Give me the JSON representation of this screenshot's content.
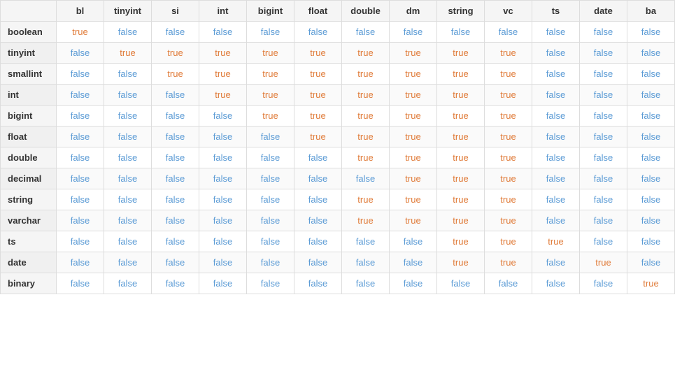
{
  "table": {
    "columns": [
      "",
      "bl",
      "tinyint",
      "si",
      "int",
      "bigint",
      "float",
      "double",
      "dm",
      "string",
      "vc",
      "ts",
      "date",
      "ba"
    ],
    "rows": [
      {
        "label": "boolean",
        "values": [
          "true",
          "false",
          "false",
          "false",
          "false",
          "false",
          "false",
          "false",
          "false",
          "false",
          "false",
          "false",
          "false"
        ]
      },
      {
        "label": "tinyint",
        "values": [
          "false",
          "true",
          "true",
          "true",
          "true",
          "true",
          "true",
          "true",
          "true",
          "true",
          "false",
          "false",
          "false"
        ]
      },
      {
        "label": "smallint",
        "values": [
          "false",
          "false",
          "true",
          "true",
          "true",
          "true",
          "true",
          "true",
          "true",
          "true",
          "false",
          "false",
          "false"
        ]
      },
      {
        "label": "int",
        "values": [
          "false",
          "false",
          "false",
          "true",
          "true",
          "true",
          "true",
          "true",
          "true",
          "true",
          "false",
          "false",
          "false"
        ]
      },
      {
        "label": "bigint",
        "values": [
          "false",
          "false",
          "false",
          "false",
          "true",
          "true",
          "true",
          "true",
          "true",
          "true",
          "false",
          "false",
          "false"
        ]
      },
      {
        "label": "float",
        "values": [
          "false",
          "false",
          "false",
          "false",
          "false",
          "true",
          "true",
          "true",
          "true",
          "true",
          "false",
          "false",
          "false"
        ]
      },
      {
        "label": "double",
        "values": [
          "false",
          "false",
          "false",
          "false",
          "false",
          "false",
          "true",
          "true",
          "true",
          "true",
          "false",
          "false",
          "false"
        ]
      },
      {
        "label": "decimal",
        "values": [
          "false",
          "false",
          "false",
          "false",
          "false",
          "false",
          "false",
          "true",
          "true",
          "true",
          "false",
          "false",
          "false"
        ]
      },
      {
        "label": "string",
        "values": [
          "false",
          "false",
          "false",
          "false",
          "false",
          "false",
          "true",
          "true",
          "true",
          "true",
          "false",
          "false",
          "false"
        ]
      },
      {
        "label": "varchar",
        "values": [
          "false",
          "false",
          "false",
          "false",
          "false",
          "false",
          "true",
          "true",
          "true",
          "true",
          "false",
          "false",
          "false"
        ]
      },
      {
        "label": "ts",
        "values": [
          "false",
          "false",
          "false",
          "false",
          "false",
          "false",
          "false",
          "false",
          "true",
          "true",
          "true",
          "false",
          "false"
        ]
      },
      {
        "label": "date",
        "values": [
          "false",
          "false",
          "false",
          "false",
          "false",
          "false",
          "false",
          "false",
          "true",
          "true",
          "false",
          "true",
          "false"
        ]
      },
      {
        "label": "binary",
        "values": [
          "false",
          "false",
          "false",
          "false",
          "false",
          "false",
          "false",
          "false",
          "false",
          "false",
          "false",
          "false",
          "true"
        ]
      }
    ]
  }
}
